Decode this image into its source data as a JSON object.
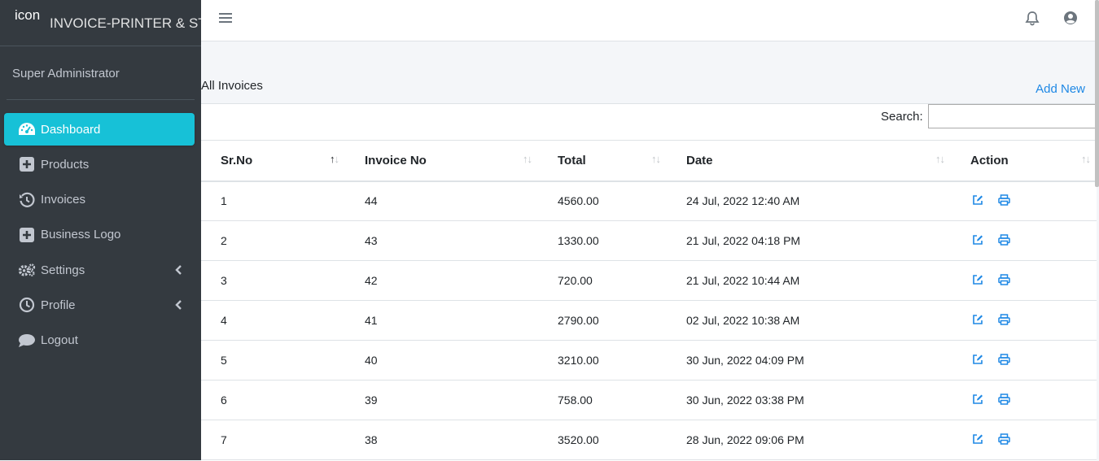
{
  "brand": {
    "logo_text": "icon",
    "title": "INVOICE-PRINTER & STOCK"
  },
  "user": {
    "name": "Super Administrator"
  },
  "nav": [
    {
      "label": "Dashboard",
      "icon": "tachometer-icon",
      "active": true
    },
    {
      "label": "Products",
      "icon": "plus-square-icon"
    },
    {
      "label": "Invoices",
      "icon": "history-icon"
    },
    {
      "label": "Business Logo",
      "icon": "plus-square-icon"
    },
    {
      "label": "Settings",
      "icon": "cogs-icon",
      "has_submenu": true
    },
    {
      "label": "Profile",
      "icon": "clock-icon",
      "has_submenu": true
    },
    {
      "label": "Logout",
      "icon": "comment-icon"
    }
  ],
  "page": {
    "title": "All Invoices",
    "add_new": "Add New"
  },
  "search": {
    "label": "Search:",
    "value": "",
    "placeholder": ""
  },
  "table": {
    "headers": [
      "Sr.No",
      "Invoice No",
      "Total",
      "Date",
      "Action"
    ],
    "sorted_column": "Sr.No",
    "sort_direction": "ascending",
    "rows": [
      {
        "sr": "1",
        "invoice": "44",
        "total": "4560.00",
        "date": "24 Jul, 2022 12:40 AM"
      },
      {
        "sr": "2",
        "invoice": "43",
        "total": "1330.00",
        "date": "21 Jul, 2022 04:18 PM"
      },
      {
        "sr": "3",
        "invoice": "42",
        "total": "720.00",
        "date": "21 Jul, 2022 10:44 AM"
      },
      {
        "sr": "4",
        "invoice": "41",
        "total": "2790.00",
        "date": "02 Jul, 2022 10:38 AM"
      },
      {
        "sr": "5",
        "invoice": "40",
        "total": "3210.00",
        "date": "30 Jun, 2022 04:09 PM"
      },
      {
        "sr": "6",
        "invoice": "39",
        "total": "758.00",
        "date": "30 Jun, 2022 03:38 PM"
      },
      {
        "sr": "7",
        "invoice": "38",
        "total": "3520.00",
        "date": "28 Jun, 2022 09:06 PM"
      }
    ]
  },
  "colors": {
    "sidebar_bg": "#343a40",
    "active_nav": "#17c1d7",
    "link": "#1e88e5",
    "action_icon": "#1e88e5",
    "content_bg": "#f4f6f9"
  }
}
